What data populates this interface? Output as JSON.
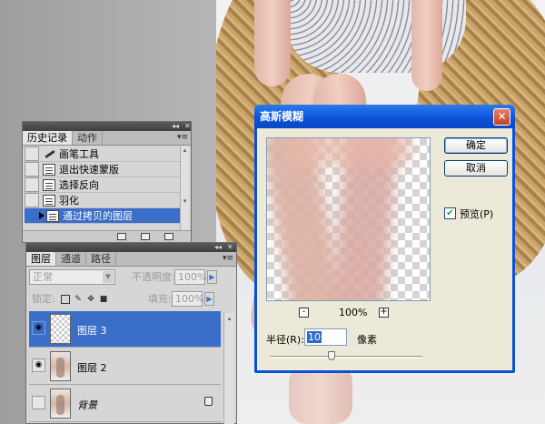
{
  "history_panel": {
    "collapse": "◂◂",
    "close": "✕",
    "tabs": [
      "历史记录",
      "动作"
    ],
    "menu": "▾≡",
    "items": [
      {
        "label": "画笔工具",
        "icon": "brush-icon"
      },
      {
        "label": "退出快速蒙版",
        "icon": "history-state-icon"
      },
      {
        "label": "选择反向",
        "icon": "history-state-icon"
      },
      {
        "label": "羽化",
        "icon": "history-state-icon"
      },
      {
        "label": "通过拷贝的图层",
        "icon": "history-state-icon",
        "selected": true
      }
    ]
  },
  "layers_panel": {
    "collapse": "◂◂",
    "close": "✕",
    "tabs": [
      "图层",
      "通道",
      "路径"
    ],
    "menu": "▾≡",
    "blend_mode": "正常",
    "opacity_label": "不透明度:",
    "opacity_value": "100%",
    "lock_label": "锁定:",
    "fill_label": "填充:",
    "fill_value": "100%",
    "layers": [
      {
        "name": "图层 3",
        "thumb": "transparent",
        "visible": true,
        "selected": true
      },
      {
        "name": "图层 2",
        "thumb": "photo",
        "visible": true,
        "selected": false
      },
      {
        "name": "背景",
        "thumb": "photo",
        "visible": false,
        "selected": false,
        "locked": true
      }
    ]
  },
  "gaussian_dialog": {
    "title": "高斯模糊",
    "ok": "确定",
    "cancel": "取消",
    "preview_label": "预览(P)",
    "preview_checked": true,
    "zoom_out": "-",
    "zoom_value": "100%",
    "zoom_in": "+",
    "radius_label": "半径(R):",
    "radius_value": "10",
    "radius_unit": "像素"
  },
  "colors": {
    "selection": "#3a6ec9",
    "xp_title": "#0a52d8"
  }
}
